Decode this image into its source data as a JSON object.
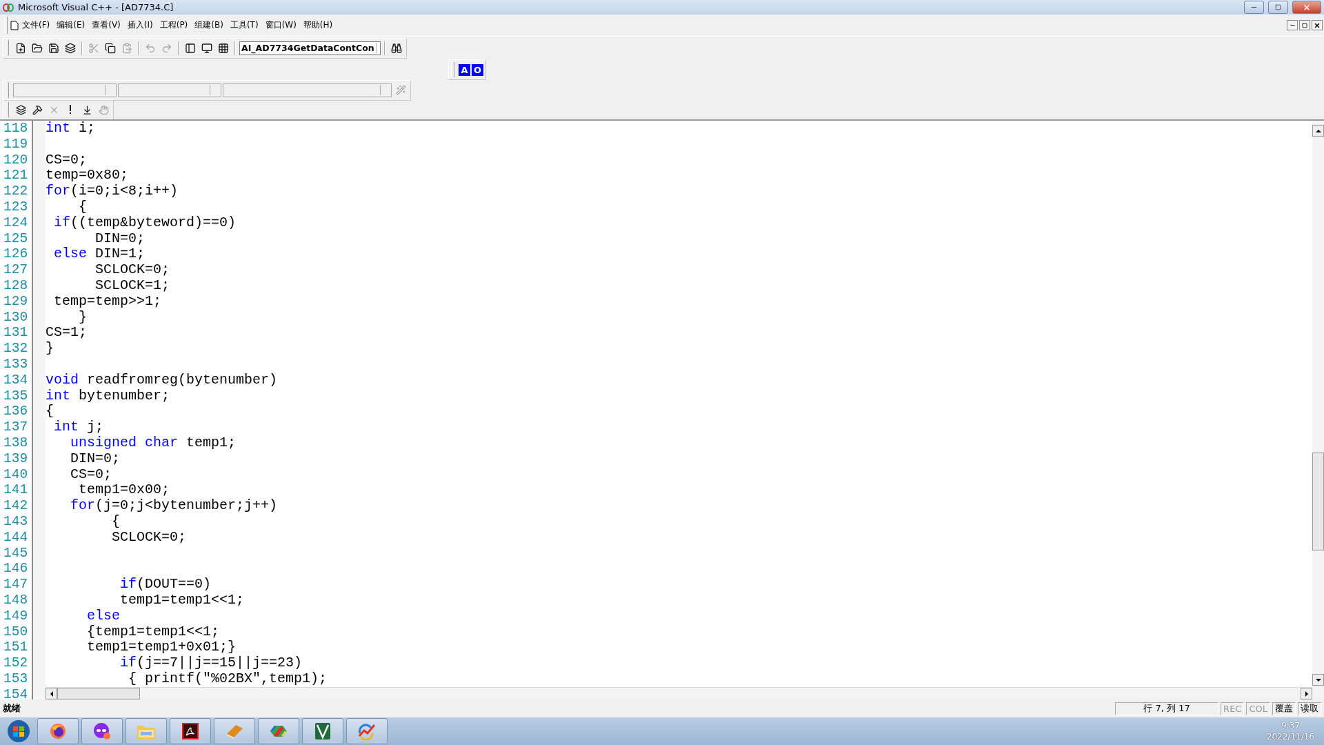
{
  "window": {
    "title": "Microsoft Visual C++ - [AD7734.C]"
  },
  "menu": [
    "文件(F)",
    "编辑(E)",
    "查看(V)",
    "插入(I)",
    "工程(P)",
    "组建(B)",
    "工具(T)",
    "窗口(W)",
    "帮助(H)"
  ],
  "standard_toolbar": {
    "buttons": [
      {
        "disabled": false
      },
      {
        "disabled": false
      },
      {
        "disabled": false
      },
      {
        "disabled": false
      },
      {
        "disabled": true
      },
      {
        "disabled": false
      },
      {
        "disabled": true
      },
      {
        "disabled": true
      },
      {
        "disabled": true
      },
      {
        "disabled": false
      },
      {
        "disabled": false
      },
      {
        "disabled": false
      },
      {
        "disabled": false
      }
    ],
    "combo": "AI_AD7734GetDataContCon"
  },
  "format_toolbar": {
    "buttons": [
      "A",
      "O"
    ]
  },
  "wizard_bar": {
    "action_disabled": true
  },
  "build_toolbar": {
    "buttons": [
      {
        "disabled": false
      },
      {
        "disabled": false
      },
      {
        "disabled": true
      },
      {
        "disabled": false
      },
      {
        "disabled": false
      },
      {
        "disabled": true
      }
    ]
  },
  "editor": {
    "lines": [
      {
        "num": "118",
        "segments": [
          {
            "text": "int",
            "kind": "keyword"
          },
          {
            "text": " i;",
            "kind": "plain"
          }
        ]
      },
      {
        "num": "119"
      },
      {
        "num": "120",
        "segments": [
          {
            "text": "CS=0;",
            "kind": "plain"
          }
        ]
      },
      {
        "num": "121",
        "segments": [
          {
            "text": "temp=0x80;",
            "kind": "plain"
          }
        ]
      },
      {
        "num": "122",
        "segments": [
          {
            "text": "for",
            "kind": "keyword"
          },
          {
            "text": "(i=0;i<8;i++)",
            "kind": "plain"
          }
        ]
      },
      {
        "num": "123",
        "segments": [
          {
            "text": "    {",
            "kind": "plain"
          }
        ]
      },
      {
        "num": "124",
        "segments": [
          {
            "text": " if",
            "kind": "keyword"
          },
          {
            "text": "((temp&byteword)==0)",
            "kind": "plain"
          }
        ]
      },
      {
        "num": "125",
        "segments": [
          {
            "text": "      DIN=0;",
            "kind": "plain"
          }
        ]
      },
      {
        "num": "126",
        "segments": [
          {
            "text": " else",
            "kind": "keyword"
          },
          {
            "text": " DIN=1;",
            "kind": "plain"
          }
        ]
      },
      {
        "num": "127",
        "segments": [
          {
            "text": "      SCLOCK=0;",
            "kind": "plain"
          }
        ]
      },
      {
        "num": "128",
        "segments": [
          {
            "text": "      SCLOCK=1;",
            "kind": "plain"
          }
        ]
      },
      {
        "num": "129",
        "segments": [
          {
            "text": " temp=temp>>1;",
            "kind": "plain"
          }
        ]
      },
      {
        "num": "130",
        "segments": [
          {
            "text": "    }",
            "kind": "plain"
          }
        ]
      },
      {
        "num": "131",
        "segments": [
          {
            "text": "CS=1;",
            "kind": "plain"
          }
        ]
      },
      {
        "num": "132",
        "segments": [
          {
            "text": "}",
            "kind": "plain"
          }
        ]
      },
      {
        "num": "133"
      },
      {
        "num": "134",
        "segments": [
          {
            "text": "void",
            "kind": "keyword"
          },
          {
            "text": " readfromreg(bytenumber)",
            "kind": "plain"
          }
        ]
      },
      {
        "num": "135",
        "segments": [
          {
            "text": "int",
            "kind": "keyword"
          },
          {
            "text": " bytenumber;",
            "kind": "plain"
          }
        ]
      },
      {
        "num": "136",
        "segments": [
          {
            "text": "{",
            "kind": "plain"
          }
        ]
      },
      {
        "num": "137",
        "segments": [
          {
            "text": " int",
            "kind": "keyword"
          },
          {
            "text": " j;",
            "kind": "plain"
          }
        ]
      },
      {
        "num": "138",
        "segments": [
          {
            "text": "   unsigned char",
            "kind": "keyword"
          },
          {
            "text": " temp1;",
            "kind": "plain"
          }
        ]
      },
      {
        "num": "139",
        "segments": [
          {
            "text": "   DIN=0;",
            "kind": "plain"
          }
        ]
      },
      {
        "num": "140",
        "segments": [
          {
            "text": "   CS=0;",
            "kind": "plain"
          }
        ]
      },
      {
        "num": "141",
        "segments": [
          {
            "text": "    temp1=0x00;",
            "kind": "plain"
          }
        ]
      },
      {
        "num": "142",
        "segments": [
          {
            "text": "   for",
            "kind": "keyword"
          },
          {
            "text": "(j=0;j<bytenumber;j++)",
            "kind": "plain"
          }
        ]
      },
      {
        "num": "143",
        "segments": [
          {
            "text": "        {",
            "kind": "plain"
          }
        ]
      },
      {
        "num": "144",
        "segments": [
          {
            "text": "        SCLOCK=0;",
            "kind": "plain"
          }
        ]
      },
      {
        "num": "145"
      },
      {
        "num": "146"
      },
      {
        "num": "147",
        "segments": [
          {
            "text": "         if",
            "kind": "keyword"
          },
          {
            "text": "(DOUT==0)",
            "kind": "plain"
          }
        ]
      },
      {
        "num": "148",
        "segments": [
          {
            "text": "         temp1=temp1<<1;",
            "kind": "plain"
          }
        ]
      },
      {
        "num": "149",
        "segments": [
          {
            "text": "     else",
            "kind": "keyword"
          }
        ]
      },
      {
        "num": "150",
        "segments": [
          {
            "text": "     {temp1=temp1<<1;",
            "kind": "plain"
          }
        ]
      },
      {
        "num": "151",
        "segments": [
          {
            "text": "     temp1=temp1+0x01;}",
            "kind": "plain"
          }
        ]
      },
      {
        "num": "152",
        "segments": [
          {
            "text": "         if",
            "kind": "keyword"
          },
          {
            "text": "(j==7||j==15||j==23)",
            "kind": "plain"
          }
        ]
      },
      {
        "num": "153",
        "segments": [
          {
            "text": "          { printf(\"%02BX\",temp1);",
            "kind": "plain"
          }
        ]
      },
      {
        "num": "154"
      }
    ]
  },
  "status_bar": {
    "message": "就绪",
    "position": "行 7, 列 17",
    "indicators": [
      {
        "label": "REC",
        "on": false
      },
      {
        "label": "COL",
        "on": false
      },
      {
        "label": "覆盖",
        "on": true
      },
      {
        "label": "读取",
        "on": true
      }
    ]
  },
  "taskbar": {
    "time": "9:37",
    "date": "2022/11/16"
  }
}
